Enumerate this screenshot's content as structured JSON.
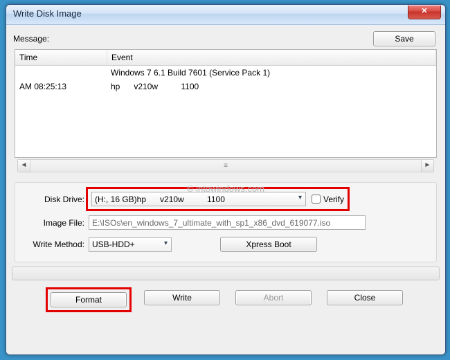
{
  "window": {
    "title": "Write Disk Image"
  },
  "message_label": "Message:",
  "save_label": "Save",
  "columns": {
    "time": "Time",
    "event": "Event"
  },
  "log": [
    {
      "time": "",
      "event": "Windows 7 6.1 Build 7601 (Service Pack 1)"
    },
    {
      "time": "AM 08:25:13",
      "event": "hp      v210w          1100"
    }
  ],
  "watermark": "© intowindows.com",
  "form": {
    "disk_drive_label": "Disk Drive:",
    "disk_drive_value": "(H:, 16 GB)hp      v210w          1100",
    "verify_label": "Verify",
    "image_file_label": "Image File:",
    "image_file_value": "E:\\ISOs\\en_windows_7_ultimate_with_sp1_x86_dvd_619077.iso",
    "write_method_label": "Write Method:",
    "write_method_value": "USB-HDD+",
    "xpress_boot_label": "Xpress Boot"
  },
  "buttons": {
    "format": "Format",
    "write": "Write",
    "abort": "Abort",
    "close": "Close"
  }
}
